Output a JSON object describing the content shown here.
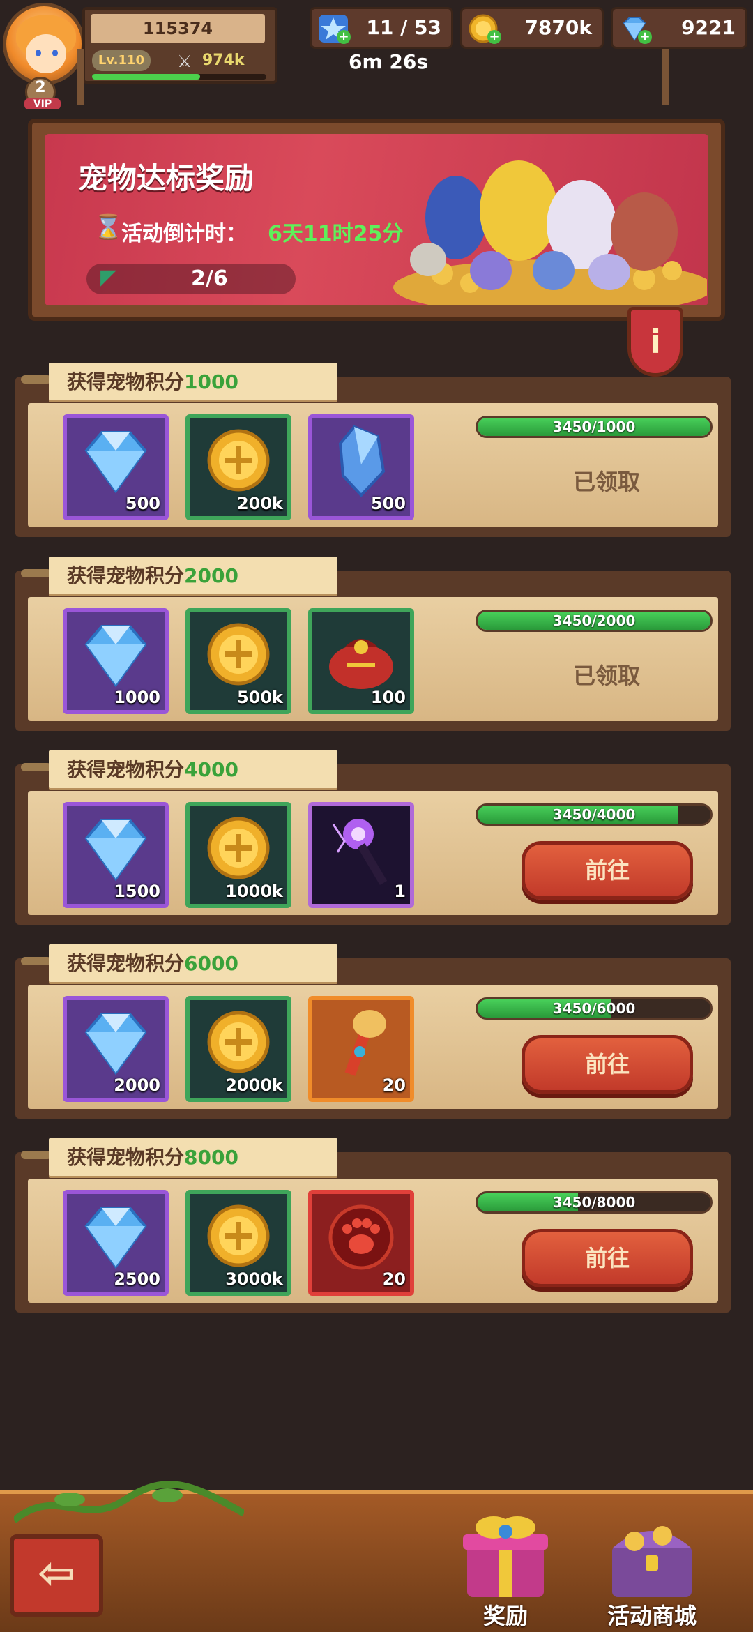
{
  "player": {
    "id": "115374",
    "level": "Lv.110",
    "power": "974k",
    "vip_level": "2",
    "vip_label": "VIP",
    "exp_fraction": 0.62
  },
  "resources": {
    "stamina": "11 / 53",
    "stamina_timer": "6m 26s",
    "gold": "7870k",
    "gems": "9221"
  },
  "banner": {
    "title": "宠物达标奖励",
    "countdown_label": "活动倒计时：",
    "countdown_value": "6天11时25分",
    "progress": "2/6"
  },
  "info_button": "i",
  "tiers": [
    {
      "label": "获得宠物积分",
      "points": "1000",
      "progress_text": "3450/1000",
      "progress_fraction": 1.0,
      "items": [
        {
          "kind": "gem",
          "qty": "500"
        },
        {
          "kind": "gold-coin",
          "qty": "200k"
        },
        {
          "kind": "crystal-shard",
          "qty": "500"
        }
      ],
      "status": "claimed",
      "status_text": "已领取"
    },
    {
      "label": "获得宠物积分",
      "points": "2000",
      "progress_text": "3450/2000",
      "progress_fraction": 1.0,
      "items": [
        {
          "kind": "gem",
          "qty": "1000"
        },
        {
          "kind": "gold-coin",
          "qty": "500k"
        },
        {
          "kind": "lucky-bag",
          "qty": "100"
        }
      ],
      "status": "claimed",
      "status_text": "已领取"
    },
    {
      "label": "获得宠物积分",
      "points": "4000",
      "progress_text": "3450/4000",
      "progress_fraction": 0.8625,
      "items": [
        {
          "kind": "gem",
          "qty": "1500"
        },
        {
          "kind": "gold-coin",
          "qty": "1000k"
        },
        {
          "kind": "magic-wand",
          "qty": "1"
        }
      ],
      "status": "go",
      "status_text": "前往"
    },
    {
      "label": "获得宠物积分",
      "points": "6000",
      "progress_text": "3450/6000",
      "progress_fraction": 0.575,
      "items": [
        {
          "kind": "gem",
          "qty": "2000"
        },
        {
          "kind": "gold-coin",
          "qty": "2000k"
        },
        {
          "kind": "golden-scepter",
          "qty": "20"
        }
      ],
      "status": "go",
      "status_text": "前往"
    },
    {
      "label": "获得宠物积分",
      "points": "8000",
      "progress_text": "3450/8000",
      "progress_fraction": 0.43125,
      "items": [
        {
          "kind": "gem",
          "qty": "2500"
        },
        {
          "kind": "gold-coin",
          "qty": "3000k"
        },
        {
          "kind": "paw-token",
          "qty": "20"
        }
      ],
      "status": "go",
      "status_text": "前往"
    }
  ],
  "bottom_nav": {
    "back_icon": "back-arrow-icon",
    "rewards_label": "奖励",
    "shop_label": "活动商城"
  },
  "colors": {
    "accent_green": "#3aa23a",
    "countdown_green": "#5ff05a",
    "button_red": "#c23a2a"
  }
}
